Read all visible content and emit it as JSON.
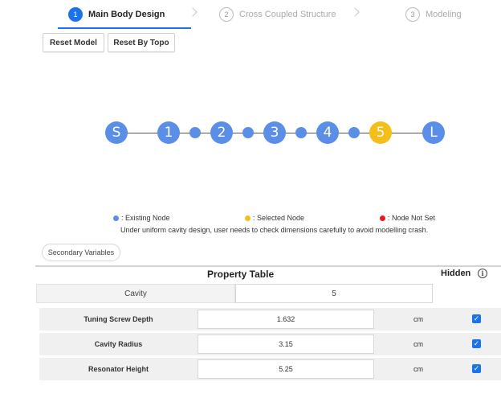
{
  "stepper": {
    "steps": [
      {
        "number": "1",
        "label": "Main Body Design",
        "state": "active"
      },
      {
        "number": "2",
        "label": "Cross Coupled Structure",
        "state": "inactive"
      },
      {
        "number": "3",
        "label": "Modeling",
        "state": "inactive"
      }
    ]
  },
  "toolbar": {
    "reset_model_label": "Reset Model",
    "reset_by_topo_label": "Reset By Topo"
  },
  "topology": {
    "nodes": [
      {
        "label": "S",
        "size": "big",
        "state": "existing"
      },
      {
        "label": "1",
        "size": "big",
        "state": "existing"
      },
      {
        "label": "",
        "size": "small",
        "state": "existing"
      },
      {
        "label": "2",
        "size": "big",
        "state": "existing"
      },
      {
        "label": "",
        "size": "small",
        "state": "existing"
      },
      {
        "label": "3",
        "size": "big",
        "state": "existing"
      },
      {
        "label": "",
        "size": "small",
        "state": "existing"
      },
      {
        "label": "4",
        "size": "big",
        "state": "existing"
      },
      {
        "label": "",
        "size": "small",
        "state": "existing"
      },
      {
        "label": "5",
        "size": "big",
        "state": "selected"
      },
      {
        "label": "L",
        "size": "big",
        "state": "existing"
      }
    ],
    "colors": {
      "existing": "#5b8ee6",
      "selected": "#f5be1a",
      "not_set": "#e8191d"
    }
  },
  "legend": {
    "existing": ": Existing Node",
    "selected": ": Selected Node",
    "not_set": ": Node Not Set",
    "warning": "Under uniform cavity design, user needs to check dimensions carefully to avoid modelling crash."
  },
  "secondary_variables_label": "Secondary Variables",
  "property_table": {
    "title": "Property Table",
    "hidden_label": "Hidden",
    "info_icon": "i",
    "cavity_label": "Cavity",
    "cavity_value": "5",
    "rows": [
      {
        "label": "Tuning Screw Depth",
        "value": "1.632",
        "unit": "cm",
        "hidden": true,
        "check": "✓"
      },
      {
        "label": "Cavity Radius",
        "value": "3.15",
        "unit": "cm",
        "hidden": true,
        "check": "✓"
      },
      {
        "label": "Resonator Height",
        "value": "5.25",
        "unit": "cm",
        "hidden": true,
        "check": "✓"
      }
    ]
  }
}
